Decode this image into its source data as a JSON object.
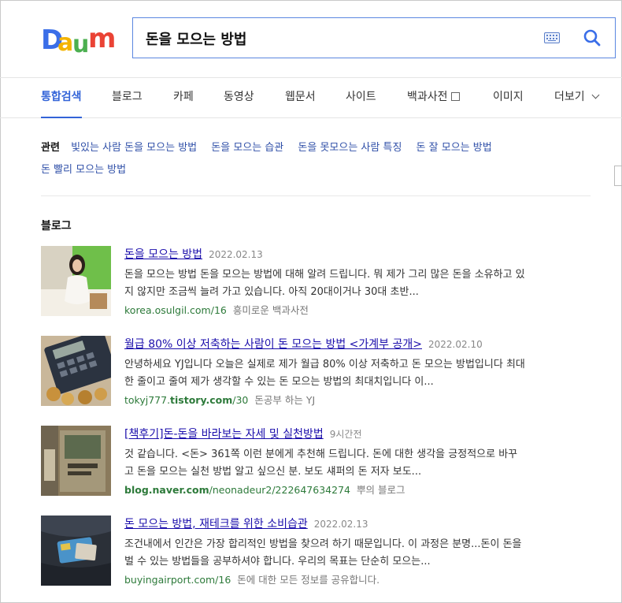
{
  "logo": {
    "text": "Daum"
  },
  "search": {
    "query": "돈을 모으는 방법"
  },
  "tabs": [
    {
      "label": "통합검색",
      "active": true
    },
    {
      "label": "블로그"
    },
    {
      "label": "카페"
    },
    {
      "label": "동영상"
    },
    {
      "label": "웹문서"
    },
    {
      "label": "사이트"
    },
    {
      "label": "백과사전"
    },
    {
      "label": "이미지"
    },
    {
      "label": "더보기"
    }
  ],
  "related": {
    "title": "관련",
    "items": [
      "빛있는 사람 돈을 모으는 방법",
      "돈을 모으는 습관",
      "돈을 못모으는 사람 특징",
      "돈 잘 모으는 방법",
      "돈 빨리 모으는 방법"
    ]
  },
  "section": {
    "title": "블로그"
  },
  "results": [
    {
      "title": "돈을 모으는 방법",
      "date": "2022.02.13",
      "desc1": "돈을 모으는 방법 돈을 모으는 방법에 대해 알려 드립니다. 뭐 제가 그리 많은 돈을 소유하고 있",
      "desc2": "지 않지만 조금씩 늘려 가고 있습니다. 아직 20대이거나 30대 초반...",
      "url": "korea.osulgil.com/16",
      "source": "흥미로운 백과사전"
    },
    {
      "title": "월급 80% 이상 저축하는 사람이 돈 모으는 방법 <가계부 공개>",
      "date": "2022.02.10",
      "desc1": "안녕하세요 YJ입니다 오늘은 실제로 제가 월급 80% 이상 저축하고 돈 모으는 방법입니다 최대",
      "desc2": "한 줄이고 줄여 제가 생각할 수 있는 돈 모으는 방법의 최대치입니다 이...",
      "url_pre": "tokyj777.",
      "url_bold": "tistory.com",
      "url_post": "/30",
      "source": "돈공부 하는 YJ"
    },
    {
      "title": "[책후기]돈-돈을 바라보는 자세 및 실천방법",
      "date": "9시간전",
      "desc1": "것 같습니다. <돈> 361쪽    이런 분에게 추천해 드립니다. 돈에 대한 생각을 긍정적으로 바꾸",
      "desc2": "고 돈을 모으는 실천 방법 알고 싶으신 분. 보도 섀퍼의 돈 저자 보도...",
      "url_bold": "blog.naver.com",
      "url_post": "/neonadeur2/222647634274",
      "source": "뿌의 블로그"
    },
    {
      "title": "돈 모으는 방법, 재테크를 위한 소비습관",
      "date": "2022.02.13",
      "desc1": "조건내에서 인간은 가장 합리적인 방법을 찾으려 하기 때문입니다. 이 과정은 분명...돈이 돈을",
      "desc2": "벌 수 있는 방법들을 공부하셔야 합니다. 우리의 목표는 단순히 모으는...",
      "url": "buyingairport.com/16",
      "source": "돈에 대한 모든 정보를 공유합니다."
    }
  ],
  "colors": {
    "accent": "#3364d8",
    "link": "#1a0dab",
    "url": "#2d7a3a",
    "related": "#3050a8"
  }
}
